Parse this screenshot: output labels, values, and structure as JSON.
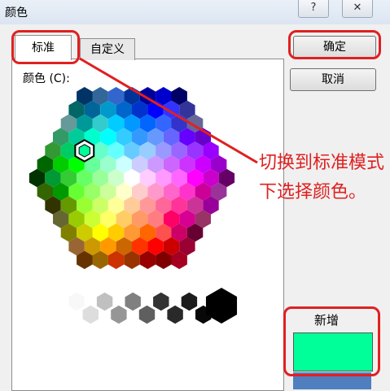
{
  "window": {
    "title": "颜色",
    "help_label": "?",
    "close_label": "✕"
  },
  "tabs": [
    {
      "label": "标准"
    },
    {
      "label": "自定义"
    }
  ],
  "color_label": "颜色 (C):",
  "buttons": {
    "ok": "确定",
    "cancel": "取消"
  },
  "preview": {
    "new_label": "新增",
    "new_color": "#00ff99",
    "current_color": "#4f7fbf"
  },
  "annotation": {
    "text": "切换到标准模式下选择颜色。",
    "color": "#e02020"
  },
  "colors": {
    "hex_rows": [
      [
        "#003366",
        "#336699",
        "#3366cc",
        "#003399",
        "#000099",
        "#0000cc",
        "#000066"
      ],
      [
        "#006666",
        "#006699",
        "#0099cc",
        "#0066cc",
        "#0033cc",
        "#0000ff",
        "#3333ff",
        "#333399"
      ],
      [
        "#669999",
        "#009999",
        "#33cccc",
        "#00ccff",
        "#0099ff",
        "#0066ff",
        "#3366ff",
        "#3333cc",
        "#666699"
      ],
      [
        "#339966",
        "#00cc99",
        "#00ffcc",
        "#00ffff",
        "#33ccff",
        "#3399ff",
        "#6699ff",
        "#6666ff",
        "#6600ff",
        "#6600cc"
      ],
      [
        "#339933",
        "#00cc66",
        "#00ff99",
        "#66ffcc",
        "#66ffff",
        "#66ccff",
        "#99ccff",
        "#9999ff",
        "#9966ff",
        "#9933ff",
        "#9900ff"
      ],
      [
        "#006600",
        "#00cc00",
        "#00ff00",
        "#66ff99",
        "#99ffcc",
        "#ccffff",
        "#ccccff",
        "#cc99ff",
        "#cc66ff",
        "#cc33ff",
        "#cc00ff",
        "#9900cc"
      ],
      [
        "#003300",
        "#009933",
        "#33cc33",
        "#66ff66",
        "#99ff99",
        "#ccffcc",
        "#ffffff",
        "#ffccff",
        "#ff99ff",
        "#ff66ff",
        "#ff00ff",
        "#cc00cc",
        "#660066"
      ],
      [
        "#336600",
        "#009900",
        "#66ff33",
        "#99ff66",
        "#ccff99",
        "#ffffcc",
        "#ffcccc",
        "#ff99cc",
        "#ff66cc",
        "#ff33cc",
        "#cc0099",
        "#993399"
      ],
      [
        "#333300",
        "#669900",
        "#99ff33",
        "#ccff66",
        "#ffff99",
        "#ffcc99",
        "#ff9999",
        "#ff6699",
        "#ff3399",
        "#cc3399",
        "#990099"
      ],
      [
        "#666633",
        "#99cc00",
        "#ccff33",
        "#ffff66",
        "#ffcc66",
        "#ff9966",
        "#ff7c80",
        "#ff0066",
        "#d60093",
        "#993366"
      ],
      [
        "#808000",
        "#cccc00",
        "#ffff00",
        "#ffcc00",
        "#ff9933",
        "#ff6600",
        "#ff5050",
        "#cc0066",
        "#660033"
      ],
      [
        "#996633",
        "#cc9900",
        "#ff9900",
        "#cc6600",
        "#ff3300",
        "#ff0000",
        "#cc0000",
        "#990033"
      ],
      [
        "#663300",
        "#996600",
        "#cc3300",
        "#993300",
        "#990000",
        "#800000",
        "#a50021"
      ]
    ],
    "selected": {
      "row": 4,
      "col": 2
    },
    "grays": [
      "#f8f8f8",
      "#dddddd",
      "#c0c0c0",
      "#969696",
      "#808080",
      "#5f5f5f",
      "#333333",
      "#292929",
      "#1c1c1c",
      "#080808"
    ],
    "black": "#000000"
  }
}
